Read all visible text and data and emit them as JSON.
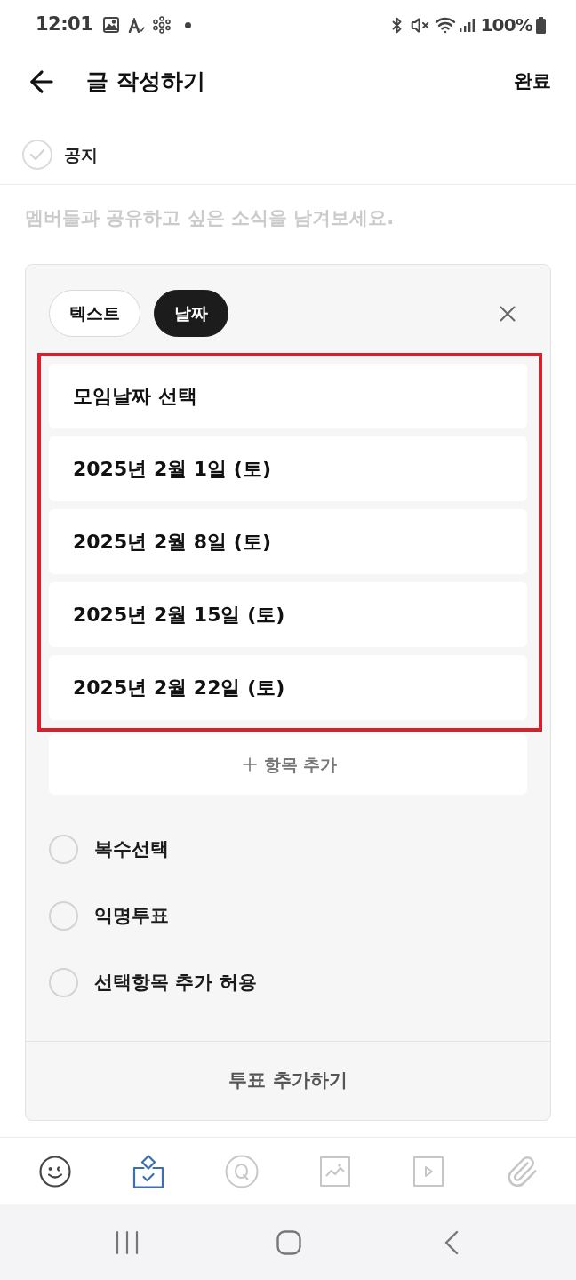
{
  "status_bar": {
    "time": "12:01",
    "battery": "100%"
  },
  "header": {
    "title": "글 작성하기",
    "done": "완료"
  },
  "notice": {
    "label": "공지",
    "checked": false
  },
  "body": {
    "placeholder": "멤버들과 공유하고 싶은 소식을 남겨보세요."
  },
  "poll": {
    "tabs": [
      {
        "label": "텍스트",
        "selected": false
      },
      {
        "label": "날짜",
        "selected": true
      }
    ],
    "title": {
      "value": "모임날짜 선택"
    },
    "options": [
      {
        "value": "2025년 2월 1일 (토)"
      },
      {
        "value": "2025년 2월 8일 (토)"
      },
      {
        "value": "2025년 2월 15일 (토)"
      },
      {
        "value": "2025년 2월 22일 (토)"
      }
    ],
    "add_option": "항목 추가",
    "settings": [
      {
        "label": "복수선택",
        "checked": false
      },
      {
        "label": "익명투표",
        "checked": false
      },
      {
        "label": "선택항목 추가 허용",
        "checked": false
      }
    ],
    "submit": "투표 추가하기"
  },
  "toolbar": [
    {
      "kind": "emoji",
      "selected": false,
      "disabled": false
    },
    {
      "kind": "poll",
      "selected": true,
      "disabled": false
    },
    {
      "kind": "quiz",
      "selected": false,
      "disabled": true
    },
    {
      "kind": "image",
      "selected": false,
      "disabled": true
    },
    {
      "kind": "video",
      "selected": false,
      "disabled": true
    },
    {
      "kind": "file",
      "selected": false,
      "disabled": true
    }
  ]
}
